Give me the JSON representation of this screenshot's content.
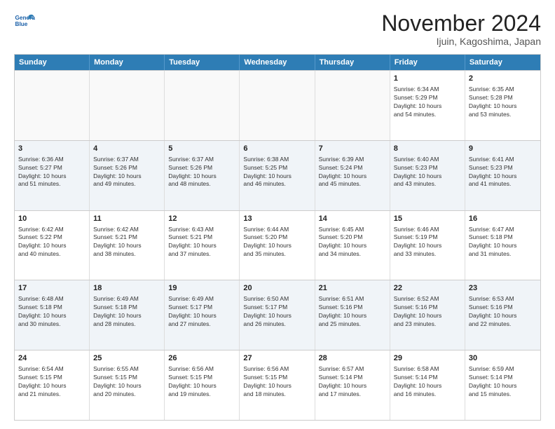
{
  "logo": {
    "line1": "General",
    "line2": "Blue"
  },
  "title": "November 2024",
  "subtitle": "Ijuin, Kagoshima, Japan",
  "headers": [
    "Sunday",
    "Monday",
    "Tuesday",
    "Wednesday",
    "Thursday",
    "Friday",
    "Saturday"
  ],
  "weeks": [
    [
      {
        "day": "",
        "info": "",
        "empty": true
      },
      {
        "day": "",
        "info": "",
        "empty": true
      },
      {
        "day": "",
        "info": "",
        "empty": true
      },
      {
        "day": "",
        "info": "",
        "empty": true
      },
      {
        "day": "",
        "info": "",
        "empty": true
      },
      {
        "day": "1",
        "info": "Sunrise: 6:34 AM\nSunset: 5:29 PM\nDaylight: 10 hours\nand 54 minutes.",
        "empty": false
      },
      {
        "day": "2",
        "info": "Sunrise: 6:35 AM\nSunset: 5:28 PM\nDaylight: 10 hours\nand 53 minutes.",
        "empty": false
      }
    ],
    [
      {
        "day": "3",
        "info": "Sunrise: 6:36 AM\nSunset: 5:27 PM\nDaylight: 10 hours\nand 51 minutes.",
        "empty": false
      },
      {
        "day": "4",
        "info": "Sunrise: 6:37 AM\nSunset: 5:26 PM\nDaylight: 10 hours\nand 49 minutes.",
        "empty": false
      },
      {
        "day": "5",
        "info": "Sunrise: 6:37 AM\nSunset: 5:26 PM\nDaylight: 10 hours\nand 48 minutes.",
        "empty": false
      },
      {
        "day": "6",
        "info": "Sunrise: 6:38 AM\nSunset: 5:25 PM\nDaylight: 10 hours\nand 46 minutes.",
        "empty": false
      },
      {
        "day": "7",
        "info": "Sunrise: 6:39 AM\nSunset: 5:24 PM\nDaylight: 10 hours\nand 45 minutes.",
        "empty": false
      },
      {
        "day": "8",
        "info": "Sunrise: 6:40 AM\nSunset: 5:23 PM\nDaylight: 10 hours\nand 43 minutes.",
        "empty": false
      },
      {
        "day": "9",
        "info": "Sunrise: 6:41 AM\nSunset: 5:23 PM\nDaylight: 10 hours\nand 41 minutes.",
        "empty": false
      }
    ],
    [
      {
        "day": "10",
        "info": "Sunrise: 6:42 AM\nSunset: 5:22 PM\nDaylight: 10 hours\nand 40 minutes.",
        "empty": false
      },
      {
        "day": "11",
        "info": "Sunrise: 6:42 AM\nSunset: 5:21 PM\nDaylight: 10 hours\nand 38 minutes.",
        "empty": false
      },
      {
        "day": "12",
        "info": "Sunrise: 6:43 AM\nSunset: 5:21 PM\nDaylight: 10 hours\nand 37 minutes.",
        "empty": false
      },
      {
        "day": "13",
        "info": "Sunrise: 6:44 AM\nSunset: 5:20 PM\nDaylight: 10 hours\nand 35 minutes.",
        "empty": false
      },
      {
        "day": "14",
        "info": "Sunrise: 6:45 AM\nSunset: 5:20 PM\nDaylight: 10 hours\nand 34 minutes.",
        "empty": false
      },
      {
        "day": "15",
        "info": "Sunrise: 6:46 AM\nSunset: 5:19 PM\nDaylight: 10 hours\nand 33 minutes.",
        "empty": false
      },
      {
        "day": "16",
        "info": "Sunrise: 6:47 AM\nSunset: 5:18 PM\nDaylight: 10 hours\nand 31 minutes.",
        "empty": false
      }
    ],
    [
      {
        "day": "17",
        "info": "Sunrise: 6:48 AM\nSunset: 5:18 PM\nDaylight: 10 hours\nand 30 minutes.",
        "empty": false
      },
      {
        "day": "18",
        "info": "Sunrise: 6:49 AM\nSunset: 5:18 PM\nDaylight: 10 hours\nand 28 minutes.",
        "empty": false
      },
      {
        "day": "19",
        "info": "Sunrise: 6:49 AM\nSunset: 5:17 PM\nDaylight: 10 hours\nand 27 minutes.",
        "empty": false
      },
      {
        "day": "20",
        "info": "Sunrise: 6:50 AM\nSunset: 5:17 PM\nDaylight: 10 hours\nand 26 minutes.",
        "empty": false
      },
      {
        "day": "21",
        "info": "Sunrise: 6:51 AM\nSunset: 5:16 PM\nDaylight: 10 hours\nand 25 minutes.",
        "empty": false
      },
      {
        "day": "22",
        "info": "Sunrise: 6:52 AM\nSunset: 5:16 PM\nDaylight: 10 hours\nand 23 minutes.",
        "empty": false
      },
      {
        "day": "23",
        "info": "Sunrise: 6:53 AM\nSunset: 5:16 PM\nDaylight: 10 hours\nand 22 minutes.",
        "empty": false
      }
    ],
    [
      {
        "day": "24",
        "info": "Sunrise: 6:54 AM\nSunset: 5:15 PM\nDaylight: 10 hours\nand 21 minutes.",
        "empty": false
      },
      {
        "day": "25",
        "info": "Sunrise: 6:55 AM\nSunset: 5:15 PM\nDaylight: 10 hours\nand 20 minutes.",
        "empty": false
      },
      {
        "day": "26",
        "info": "Sunrise: 6:56 AM\nSunset: 5:15 PM\nDaylight: 10 hours\nand 19 minutes.",
        "empty": false
      },
      {
        "day": "27",
        "info": "Sunrise: 6:56 AM\nSunset: 5:15 PM\nDaylight: 10 hours\nand 18 minutes.",
        "empty": false
      },
      {
        "day": "28",
        "info": "Sunrise: 6:57 AM\nSunset: 5:14 PM\nDaylight: 10 hours\nand 17 minutes.",
        "empty": false
      },
      {
        "day": "29",
        "info": "Sunrise: 6:58 AM\nSunset: 5:14 PM\nDaylight: 10 hours\nand 16 minutes.",
        "empty": false
      },
      {
        "day": "30",
        "info": "Sunrise: 6:59 AM\nSunset: 5:14 PM\nDaylight: 10 hours\nand 15 minutes.",
        "empty": false
      }
    ]
  ]
}
